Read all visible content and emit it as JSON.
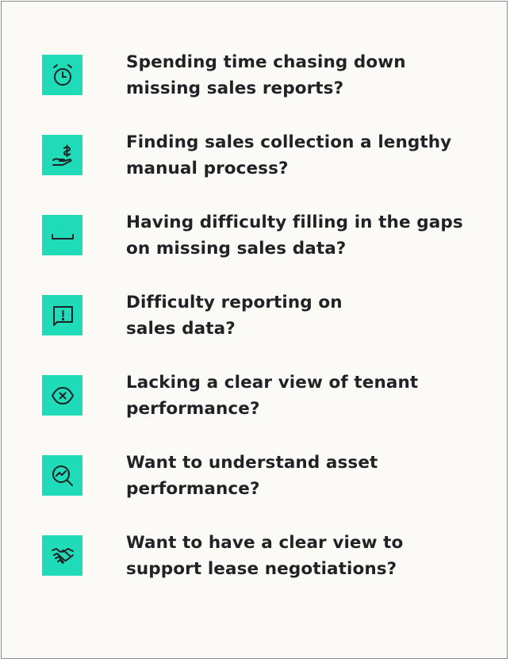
{
  "items": [
    {
      "icon": "alarm-clock-icon",
      "line1": "Spending time chasing down",
      "line2": "missing sales reports?"
    },
    {
      "icon": "hand-dollar-icon",
      "line1": "Finding sales collection a lengthy",
      "line2": "manual process?"
    },
    {
      "icon": "gap-bracket-icon",
      "line1": "Having difficulty filling in the gaps",
      "line2": "on missing sales data?"
    },
    {
      "icon": "report-alert-icon",
      "line1": "Difficulty reporting on",
      "line2": "sales data?"
    },
    {
      "icon": "diamond-x-icon",
      "line1": "Lacking a clear view of tenant",
      "line2": "performance?"
    },
    {
      "icon": "analytics-magnifier-icon",
      "line1": "Want to understand asset",
      "line2": "performance?"
    },
    {
      "icon": "handshake-icon",
      "line1": "Want to have a clear view to",
      "line2": "support lease negotiations?"
    }
  ],
  "colors": {
    "icon_background": "#20dbb7",
    "card_background": "#fcfaf6",
    "text": "#1f2325",
    "border": "#8a8a8a"
  }
}
